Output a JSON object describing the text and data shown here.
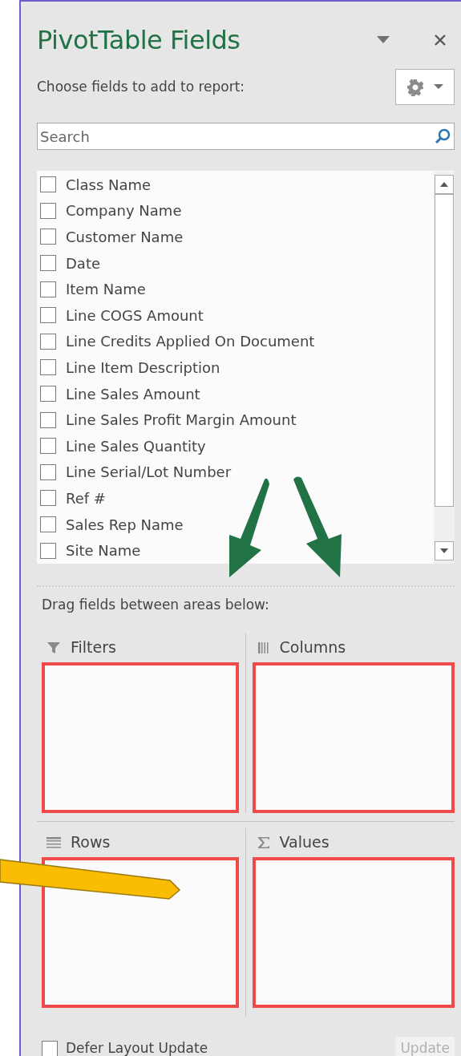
{
  "pane": {
    "title": "PivotTable Fields",
    "subtitle": "Choose fields to add to report:"
  },
  "search": {
    "placeholder": "Search"
  },
  "fields": [
    {
      "label": "Class Name",
      "checked": false
    },
    {
      "label": "Company Name",
      "checked": false
    },
    {
      "label": "Customer Name",
      "checked": false
    },
    {
      "label": "Date",
      "checked": false
    },
    {
      "label": "Item Name",
      "checked": false
    },
    {
      "label": "Line COGS Amount",
      "checked": false
    },
    {
      "label": "Line Credits Applied On Document",
      "checked": false
    },
    {
      "label": "Line Item Description",
      "checked": false
    },
    {
      "label": "Line Sales Amount",
      "checked": false
    },
    {
      "label": "Line Sales Profit Margin Amount",
      "checked": false
    },
    {
      "label": "Line Sales Quantity",
      "checked": false
    },
    {
      "label": "Line Serial/Lot Number",
      "checked": false
    },
    {
      "label": "Ref #",
      "checked": false
    },
    {
      "label": "Sales Rep Name",
      "checked": false
    },
    {
      "label": "Site Name",
      "checked": false
    }
  ],
  "drag_hint": "Drag fields between areas below:",
  "areas": [
    {
      "kind": "filters",
      "label": "Filters",
      "highlighted": true
    },
    {
      "kind": "columns",
      "label": "Columns",
      "highlighted": true
    },
    {
      "kind": "rows",
      "label": "Rows",
      "highlighted": true
    },
    {
      "kind": "values",
      "label": "Values",
      "highlighted": true
    }
  ],
  "defer": {
    "label": "Defer Layout Update",
    "checked": false
  },
  "update_button": {
    "label": "Update",
    "disabled": true
  }
}
